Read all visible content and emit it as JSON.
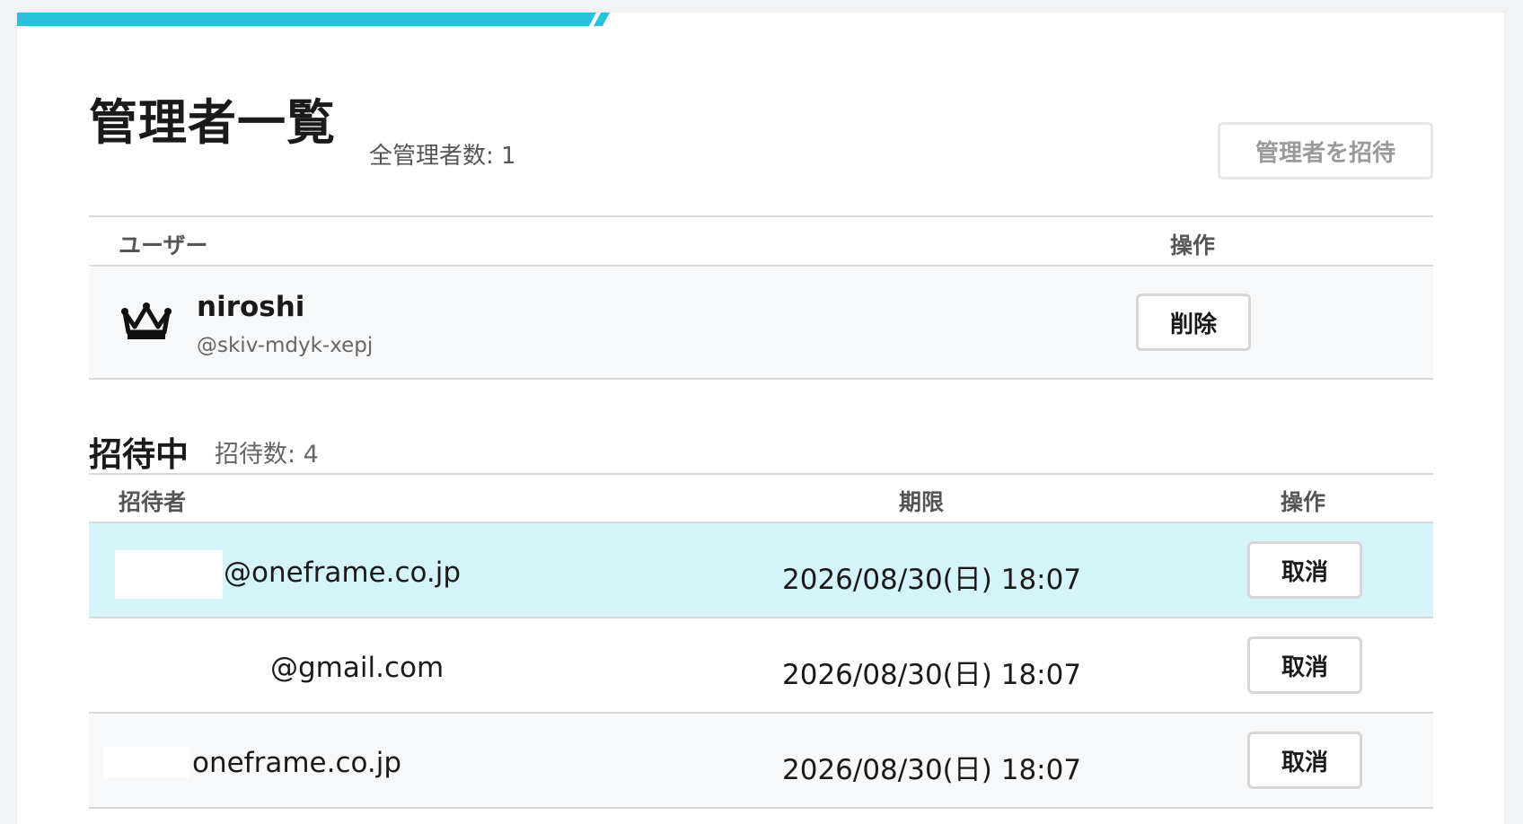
{
  "page": {
    "title": "管理者一覧",
    "total_admins": "全管理者数: 1",
    "invite_button": "管理者を招待"
  },
  "admin_table": {
    "headers": {
      "user": "ユーザー",
      "action": "操作"
    },
    "rows": [
      {
        "name": "niroshi",
        "handle": "@skiv-mdyk-xepj",
        "icon": "crown-icon",
        "action": "削除"
      }
    ]
  },
  "invites": {
    "title": "招待中",
    "count": "招待数: 4",
    "headers": {
      "inviter": "招待者",
      "deadline": "期限",
      "action": "操作"
    },
    "rows": [
      {
        "email": "@oneframe.co.jp",
        "deadline": "2026/08/30(日) 18:07",
        "action": "取消"
      },
      {
        "email": "@gmail.com",
        "deadline": "2026/08/30(日) 18:07",
        "action": "取消"
      },
      {
        "email": "oneframe.co.jp",
        "deadline": "2026/08/30(日) 18:07",
        "action": "取消"
      }
    ]
  },
  "colors": {
    "accent": "#29c2de",
    "highlight_row": "#d5f4f9",
    "alt_row": "#f6f8fa"
  }
}
